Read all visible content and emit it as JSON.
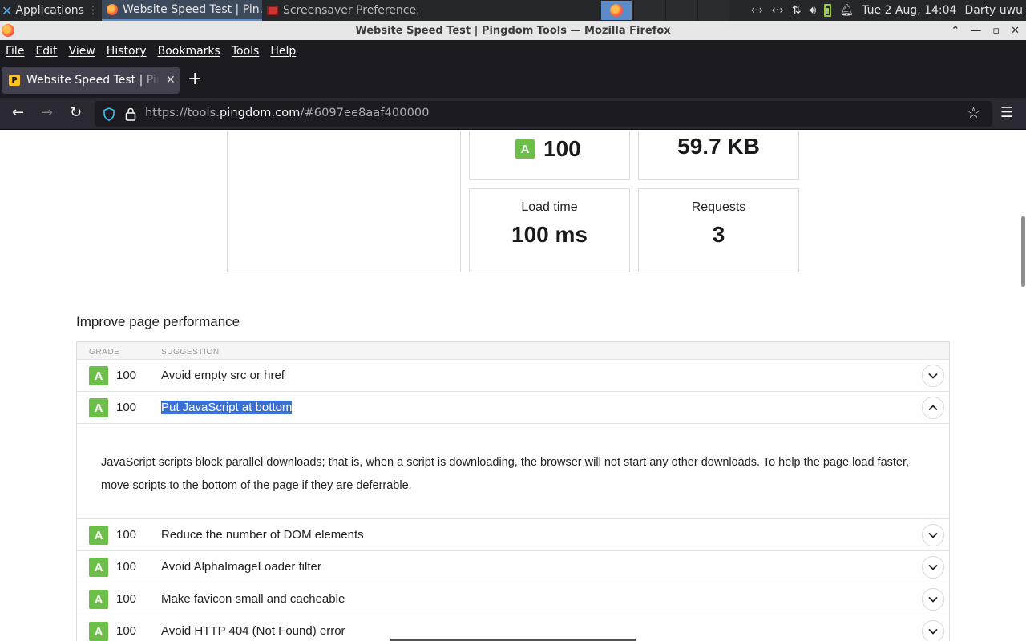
{
  "taskbar": {
    "apps_label": "Applications",
    "tasks": [
      {
        "label": "Website Speed Test | Pin..."
      },
      {
        "label": "Screensaver Preference..."
      }
    ],
    "clock": "Tue  2 Aug, 14:04",
    "user": "Darty uwu"
  },
  "window": {
    "title": "Website Speed Test | Pingdom Tools — Mozilla Firefox"
  },
  "menu": [
    "File",
    "Edit",
    "View",
    "History",
    "Bookmarks",
    "Tools",
    "Help"
  ],
  "tab": {
    "title": "Website Speed Test | Pingdom Tools",
    "favicon_letter": "P"
  },
  "urlbar": {
    "prefix": "https://tools.",
    "domain": "pingdom.com",
    "suffix": "/#6097ee8aaf400000"
  },
  "stats": {
    "grade_letter": "A",
    "grade_value": "100",
    "page_size_value": "59.7 KB",
    "load_time_label": "Load time",
    "load_time_value": "100 ms",
    "requests_label": "Requests",
    "requests_value": "3"
  },
  "improve": {
    "title": "Improve page performance",
    "col_grade": "GRADE",
    "col_suggestion": "SUGGESTION",
    "rows": [
      {
        "grade": "A",
        "score": "100",
        "suggestion": "Avoid empty src or href"
      },
      {
        "grade": "A",
        "score": "100",
        "suggestion": "Put JavaScript at bottom"
      },
      {
        "grade": "A",
        "score": "100",
        "suggestion": "Reduce the number of DOM elements"
      },
      {
        "grade": "A",
        "score": "100",
        "suggestion": "Avoid AlphaImageLoader filter"
      },
      {
        "grade": "A",
        "score": "100",
        "suggestion": "Make favicon small and cacheable"
      },
      {
        "grade": "A",
        "score": "100",
        "suggestion": "Avoid HTTP 404 (Not Found) error"
      }
    ],
    "expanded_text": "JavaScript scripts block parallel downloads; that is, when a script is downloading, the browser will not start any other downloads. To help the page load faster, move scripts to the bottom of the page if they are deferrable."
  },
  "colors": {
    "grade_green": "#6cc04a",
    "selection_blue": "#3a6fd4",
    "firefox_dark": "#1c1b22"
  }
}
